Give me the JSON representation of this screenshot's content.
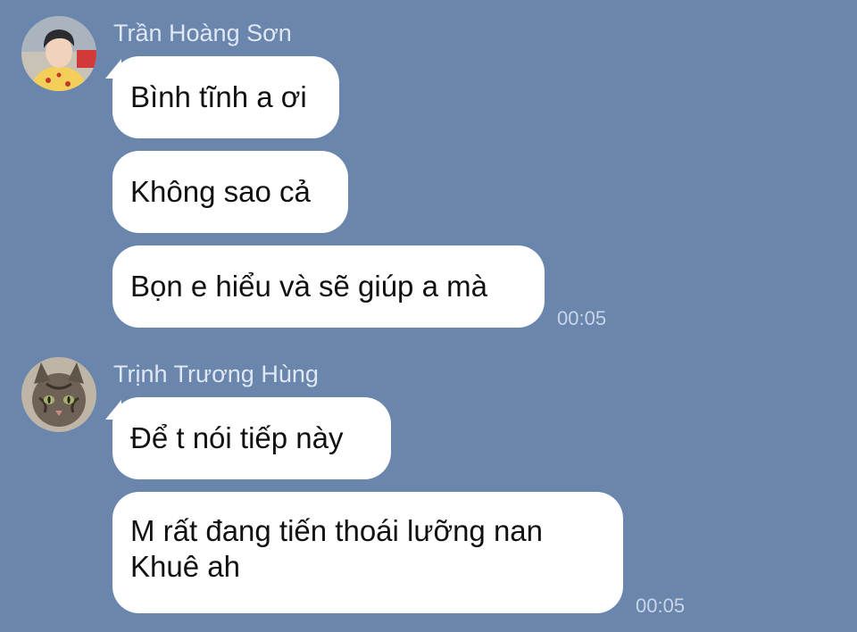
{
  "colors": {
    "background": "#6a86ad",
    "bubble": "#ffffff",
    "sender_name": "#dfe7f3",
    "timestamp": "#c9d5e6"
  },
  "groups": [
    {
      "sender": "Trần Hoàng Sơn",
      "avatar": "person-photo",
      "messages": [
        "Bình tĩnh a ơi",
        "Không sao cả",
        "Bọn e hiểu và sẽ giúp a mà"
      ],
      "time": "00:05"
    },
    {
      "sender": "Trịnh Trương Hùng",
      "avatar": "cat-photo",
      "messages": [
        "Để t nói tiếp này",
        "M rất đang tiến thoái lưỡng nan",
        "Khuê ah"
      ],
      "time": "00:05"
    }
  ]
}
